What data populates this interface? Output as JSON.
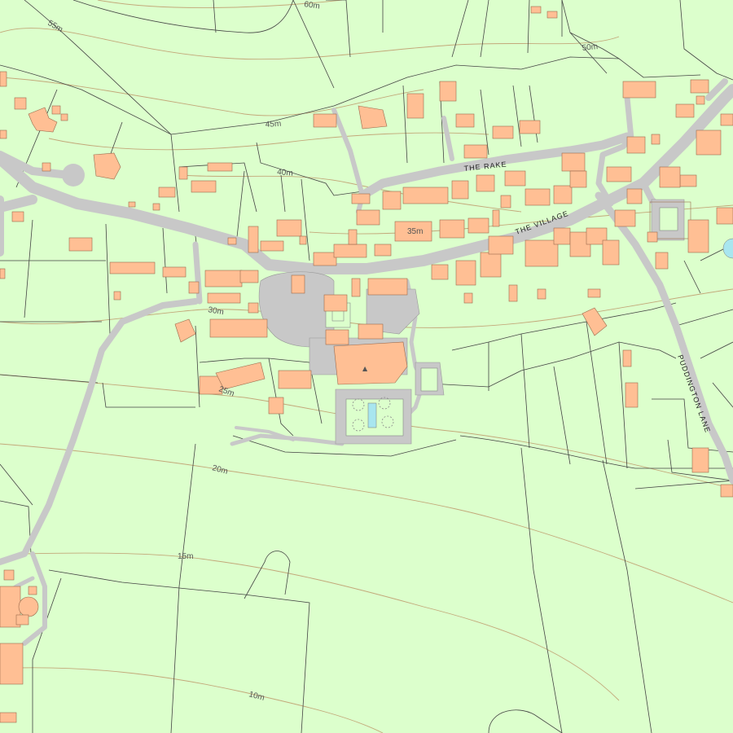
{
  "map": {
    "colors": {
      "land": "#dcffcc",
      "road": "#c8c8c8",
      "building": "#ffbf94",
      "building_outline": "#9b6a4c",
      "boundary": "#444444",
      "contour": "#c3a87a",
      "water": "#a8e6ef"
    },
    "contours": [
      {
        "label": "60m"
      },
      {
        "label": "55m"
      },
      {
        "label": "50m"
      },
      {
        "label": "45m"
      },
      {
        "label": "40m"
      },
      {
        "label": "35m"
      },
      {
        "label": "30m"
      },
      {
        "label": "25m"
      },
      {
        "label": "20m"
      },
      {
        "label": "15m"
      },
      {
        "label": "10m"
      }
    ],
    "roads": [
      {
        "name": "THE RAKE"
      },
      {
        "name": "THE VILLAGE"
      },
      {
        "name": "PUDDINGTON LANE"
      }
    ]
  }
}
